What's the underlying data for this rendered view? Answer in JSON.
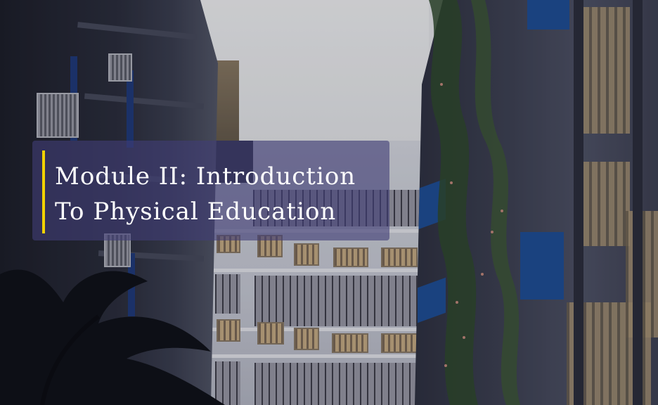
{
  "banner": {
    "title_line1": "Module II: Introduction",
    "title_line2": "To Physical Education",
    "accent_color": "#f2d200",
    "background_color": "#403e76"
  },
  "photo": {
    "subject": "school buildings courtyard"
  }
}
